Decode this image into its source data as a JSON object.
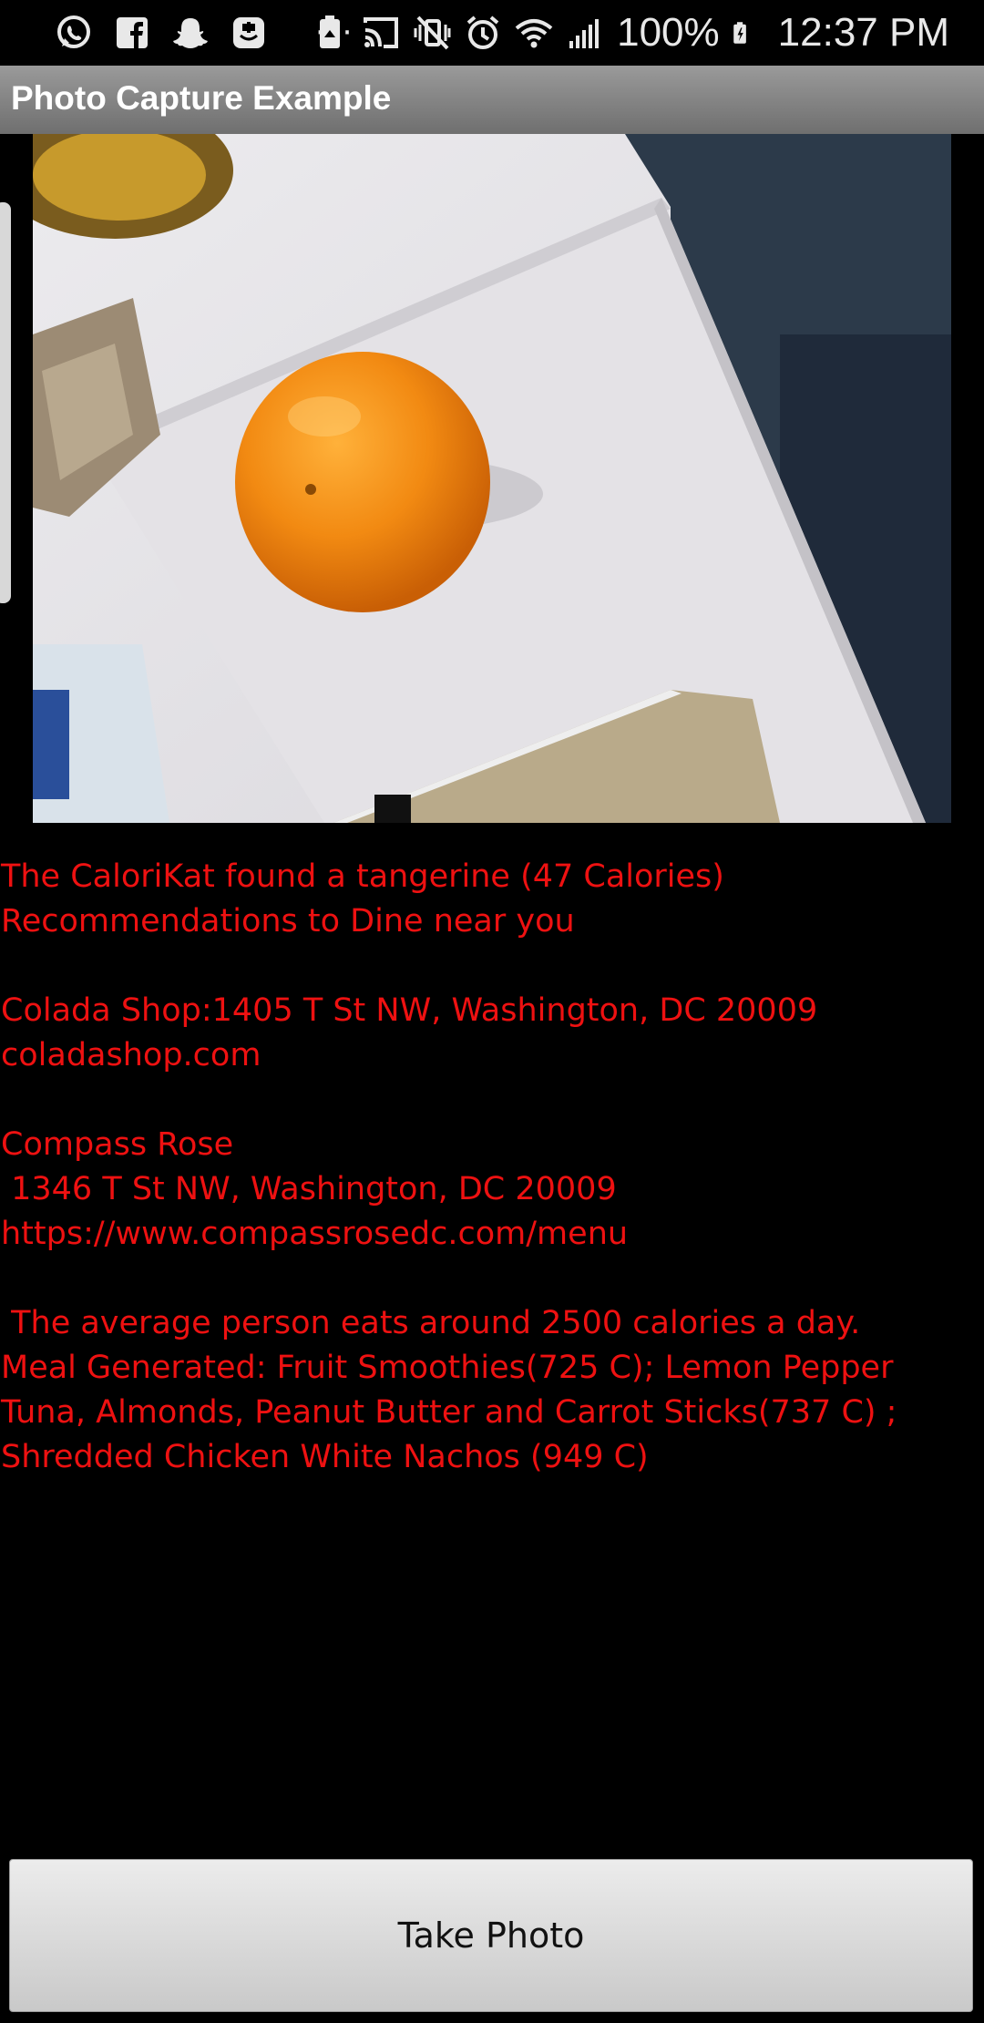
{
  "status_bar": {
    "battery": "100%",
    "time": "12:37 PM",
    "left_icons": [
      "whatsapp-icon",
      "facebook-icon",
      "snapchat-icon",
      "app-badge-icon",
      "more-dots-icon"
    ],
    "right_icons": [
      "recycle-battery-icon",
      "cast-icon",
      "vibrate-mute-icon",
      "alarm-icon",
      "wifi-icon",
      "signal-icon",
      "charging-battery-icon"
    ]
  },
  "app_bar": {
    "title": "Photo Capture Example",
    "background": "#888888"
  },
  "photo": {
    "subject": "tangerine on white table",
    "icon": "photo-image"
  },
  "result": {
    "found": "The CaloriKat found a tangerine (47 Calories)",
    "recommend_heading": "Recommendations to Dine near you",
    "places": [
      {
        "line1": "Colada Shop:1405 T St NW, Washington, DC 20009",
        "line2": "coladashop.com"
      },
      {
        "line1": "Compass Rose",
        "line2": " 1346 T St NW, Washington, DC 20009",
        "line3": "https://www.compassrosedc.com/menu"
      }
    ],
    "average": " The average person eats around 2500 calories a day.",
    "meal": "Meal Generated: Fruit Smoothies(725 C); Lemon Pepper Tuna, Almonds, Peanut Butter and Carrot Sticks(737 C) ; Shredded Chicken White Nachos (949 C)",
    "text_color": "#ee1111"
  },
  "button": {
    "label": "Take Photo"
  }
}
